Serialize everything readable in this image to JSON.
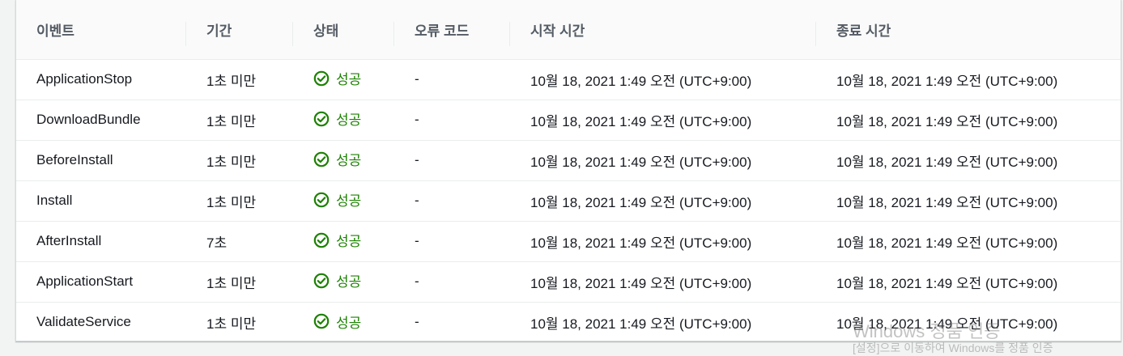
{
  "columns": [
    "이벤트",
    "기간",
    "상태",
    "오류 코드",
    "시작 시간",
    "종료 시간"
  ],
  "rows": [
    {
      "event": "ApplicationStop",
      "duration": "1초 미만",
      "status": "성공",
      "error_code": "-",
      "start": "10월 18, 2021 1:49 오전 (UTC+9:00)",
      "end": "10월 18, 2021 1:49 오전 (UTC+9:00)"
    },
    {
      "event": "DownloadBundle",
      "duration": "1초 미만",
      "status": "성공",
      "error_code": "-",
      "start": "10월 18, 2021 1:49 오전 (UTC+9:00)",
      "end": "10월 18, 2021 1:49 오전 (UTC+9:00)"
    },
    {
      "event": "BeforeInstall",
      "duration": "1초 미만",
      "status": "성공",
      "error_code": "-",
      "start": "10월 18, 2021 1:49 오전 (UTC+9:00)",
      "end": "10월 18, 2021 1:49 오전 (UTC+9:00)"
    },
    {
      "event": "Install",
      "duration": "1초 미만",
      "status": "성공",
      "error_code": "-",
      "start": "10월 18, 2021 1:49 오전 (UTC+9:00)",
      "end": "10월 18, 2021 1:49 오전 (UTC+9:00)"
    },
    {
      "event": "AfterInstall",
      "duration": "7초",
      "status": "성공",
      "error_code": "-",
      "start": "10월 18, 2021 1:49 오전 (UTC+9:00)",
      "end": "10월 18, 2021 1:49 오전 (UTC+9:00)"
    },
    {
      "event": "ApplicationStart",
      "duration": "1초 미만",
      "status": "성공",
      "error_code": "-",
      "start": "10월 18, 2021 1:49 오전 (UTC+9:00)",
      "end": "10월 18, 2021 1:49 오전 (UTC+9:00)"
    },
    {
      "event": "ValidateService",
      "duration": "1초 미만",
      "status": "성공",
      "error_code": "-",
      "start": "10월 18, 2021 1:49 오전 (UTC+9:00)",
      "end": "10월 18, 2021 1:49 오전 (UTC+9:00)"
    }
  ],
  "status_icon": "success-check-circle-icon",
  "colors": {
    "success": "#1d8102",
    "header_text": "#545b64",
    "text": "#16191f"
  },
  "watermark": {
    "title": "Windows 정품 인증",
    "subtitle": "[설정]으로 이동하여 Windows를 정품 인증"
  }
}
